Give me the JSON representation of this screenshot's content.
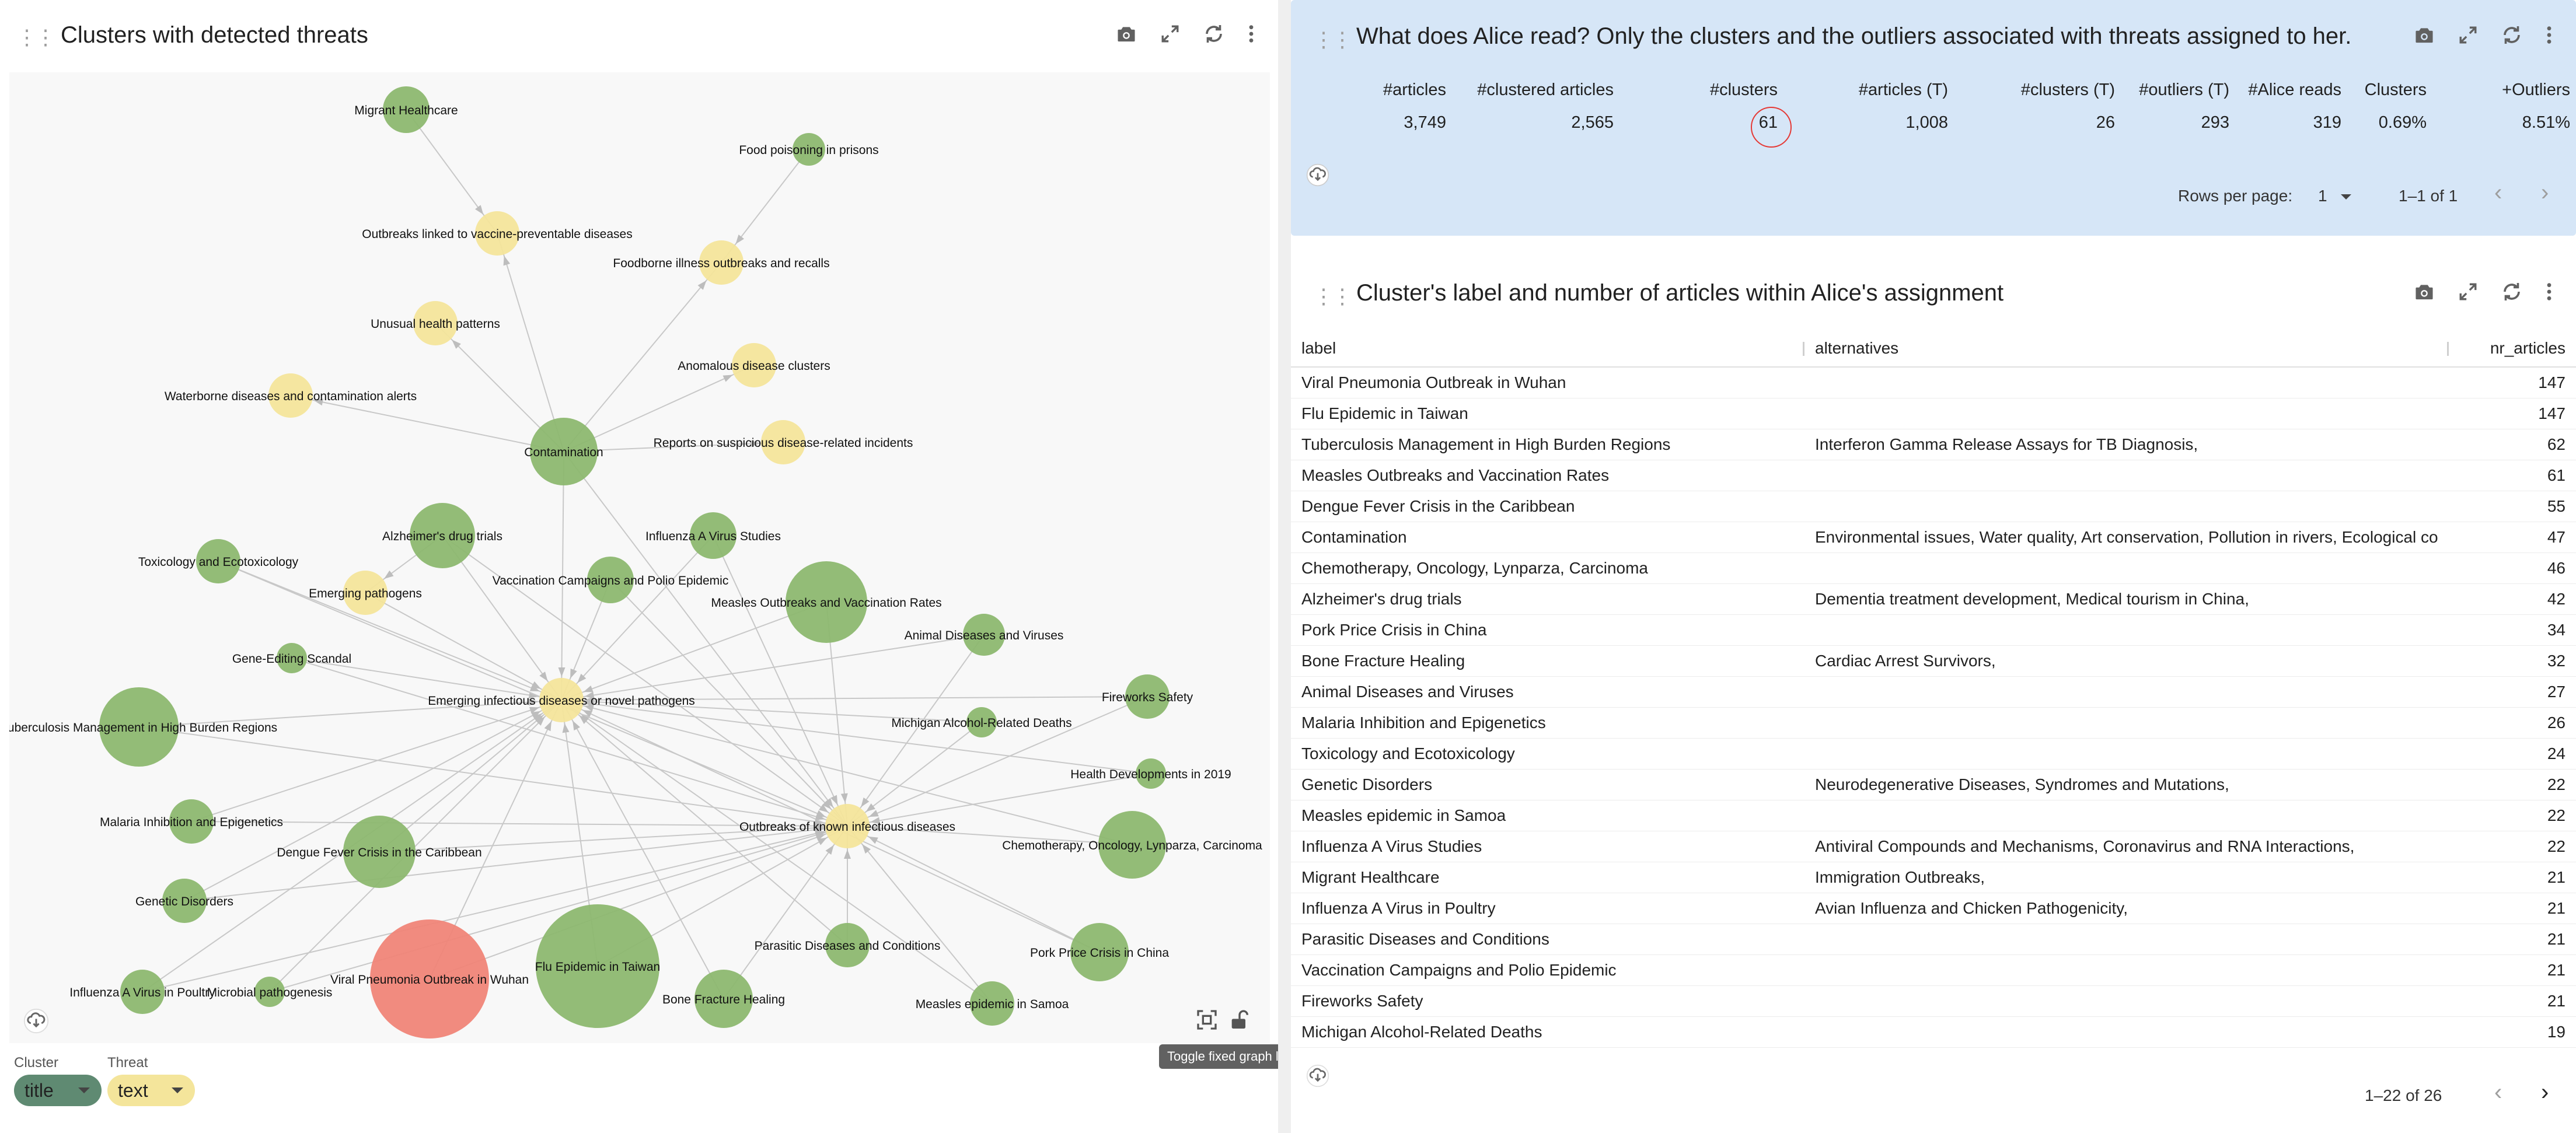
{
  "left": {
    "title": "Clusters with detected threats",
    "legend": {
      "cluster_header": "Cluster",
      "cluster_value": "title",
      "threat_header": "Threat",
      "threat_value": "text"
    },
    "tooltip": "Toggle fixed graph layout."
  },
  "colors": {
    "cluster": "#8db870",
    "threat": "#f4e59b",
    "highlight": "#f08578",
    "panel_blue": "#d6e6f7"
  },
  "graph": {
    "nodes": [
      {
        "id": "migrant",
        "label": "Migrant Healthcare",
        "kind": "cluster"
      },
      {
        "id": "food",
        "label": "Food poisoning in prisons",
        "kind": "cluster"
      },
      {
        "id": "vaccprev",
        "label": "Outbreaks linked to vaccine-preventable diseases",
        "kind": "threat"
      },
      {
        "id": "foodborne",
        "label": "Foodborne illness outbreaks and recalls",
        "kind": "threat"
      },
      {
        "id": "unusual",
        "label": "Unusual health patterns",
        "kind": "threat"
      },
      {
        "id": "anomalous",
        "label": "Anomalous disease clusters",
        "kind": "threat"
      },
      {
        "id": "waterborne",
        "label": "Waterborne diseases and contamination alerts",
        "kind": "threat"
      },
      {
        "id": "contam",
        "label": "Contamination",
        "kind": "cluster"
      },
      {
        "id": "suspicious",
        "label": "Reports on suspicious disease-related incidents",
        "kind": "threat"
      },
      {
        "id": "alz",
        "label": "Alzheimer's drug trials",
        "kind": "cluster"
      },
      {
        "id": "flua",
        "label": "Influenza A Virus Studies",
        "kind": "cluster"
      },
      {
        "id": "toxic",
        "label": "Toxicology and Ecotoxicology",
        "kind": "cluster"
      },
      {
        "id": "vaccpolio",
        "label": "Vaccination Campaigns and Polio Epidemic",
        "kind": "cluster"
      },
      {
        "id": "emerging",
        "label": "Emerging pathogens",
        "kind": "threat"
      },
      {
        "id": "measlesvacc",
        "label": "Measles Outbreaks and Vaccination Rates",
        "kind": "cluster"
      },
      {
        "id": "animal",
        "label": "Animal Diseases and Viruses",
        "kind": "cluster"
      },
      {
        "id": "gene",
        "label": "Gene-Editing Scandal",
        "kind": "cluster"
      },
      {
        "id": "fireworks",
        "label": "Fireworks Safety",
        "kind": "cluster"
      },
      {
        "id": "eid",
        "label": "Emerging infectious diseases or novel pathogens",
        "kind": "threat"
      },
      {
        "id": "tb",
        "label": "Tuberculosis Management in High Burden Regions",
        "kind": "cluster"
      },
      {
        "id": "michigan",
        "label": "Michigan Alcohol-Related Deaths",
        "kind": "cluster"
      },
      {
        "id": "health2019",
        "label": "Health Developments in 2019",
        "kind": "cluster"
      },
      {
        "id": "malaria",
        "label": "Malaria Inhibition and Epigenetics",
        "kind": "cluster"
      },
      {
        "id": "known",
        "label": "Outbreaks of known infectious diseases",
        "kind": "threat"
      },
      {
        "id": "chemo",
        "label": "Chemotherapy, Oncology, Lynparza, Carcinoma",
        "kind": "cluster"
      },
      {
        "id": "dengue",
        "label": "Dengue Fever Crisis in the Caribbean",
        "kind": "cluster"
      },
      {
        "id": "genetic",
        "label": "Genetic Disorders",
        "kind": "cluster"
      },
      {
        "id": "parasitic",
        "label": "Parasitic Diseases and Conditions",
        "kind": "cluster"
      },
      {
        "id": "pork",
        "label": "Pork Price Crisis in China",
        "kind": "cluster"
      },
      {
        "id": "fluataiwan",
        "label": "Flu Epidemic in Taiwan",
        "kind": "cluster"
      },
      {
        "id": "wuhan",
        "label": "Viral Pneumonia Outbreak in Wuhan",
        "kind": "highlight"
      },
      {
        "id": "fluapoultry",
        "label": "Influenza A Virus in Poultry",
        "kind": "cluster"
      },
      {
        "id": "microbial",
        "label": "Microbial pathogenesis",
        "kind": "cluster"
      },
      {
        "id": "bone",
        "label": "Bone Fracture Healing",
        "kind": "cluster"
      },
      {
        "id": "samoa",
        "label": "Measles epidemic in Samoa",
        "kind": "cluster"
      }
    ]
  },
  "top_right": {
    "title": "What does Alice read? Only the clusters and the outliers associated with threats assigned to her.",
    "headers": [
      "#articles",
      "#clustered articles",
      "#clusters",
      "#articles (T)",
      "#clusters (T)",
      "#outliers (T)",
      "#Alice reads",
      "Clusters",
      "+Outliers"
    ],
    "values": [
      "3,749",
      "2,565",
      "61",
      "1,008",
      "26",
      "293",
      "319",
      "0.69%",
      "8.51%"
    ],
    "rows_per_page_label": "Rows per page:",
    "rows_per_page_value": "1",
    "range": "1–1 of 1"
  },
  "bottom_right": {
    "title": "Cluster's label and number of articles within Alice's assignment",
    "columns": [
      "label",
      "alternatives",
      "nr_articles"
    ],
    "rows": [
      [
        "Viral Pneumonia Outbreak in Wuhan",
        "",
        "147"
      ],
      [
        "Flu Epidemic in Taiwan",
        "",
        "147"
      ],
      [
        "Tuberculosis Management in High Burden Regions",
        "Interferon Gamma Release Assays for TB Diagnosis,",
        "62"
      ],
      [
        "Measles Outbreaks and Vaccination Rates",
        "",
        "61"
      ],
      [
        "Dengue Fever Crisis in the Caribbean",
        "",
        "55"
      ],
      [
        "Contamination",
        "Environmental issues, Water quality, Art conservation, Pollution in rivers, Ecological co",
        "47"
      ],
      [
        "Chemotherapy, Oncology, Lynparza, Carcinoma",
        "",
        "46"
      ],
      [
        "Alzheimer's drug trials",
        "Dementia treatment development, Medical tourism in China,",
        "42"
      ],
      [
        "Pork Price Crisis in China",
        "",
        "34"
      ],
      [
        "Bone Fracture Healing",
        "Cardiac Arrest Survivors,",
        "32"
      ],
      [
        "Animal Diseases and Viruses",
        "",
        "27"
      ],
      [
        "Malaria Inhibition and Epigenetics",
        "",
        "26"
      ],
      [
        "Toxicology and Ecotoxicology",
        "",
        "24"
      ],
      [
        "Genetic Disorders",
        "Neurodegenerative Diseases, Syndromes and Mutations,",
        "22"
      ],
      [
        "Measles epidemic in Samoa",
        "",
        "22"
      ],
      [
        "Influenza A Virus Studies",
        "Antiviral Compounds and Mechanisms, Coronavirus and RNA Interactions,",
        "22"
      ],
      [
        "Migrant Healthcare",
        "Immigration Outbreaks,",
        "21"
      ],
      [
        "Influenza A Virus in Poultry",
        "Avian Influenza and Chicken Pathogenicity,",
        "21"
      ],
      [
        "Parasitic Diseases and Conditions",
        "",
        "21"
      ],
      [
        "Vaccination Campaigns and Polio Epidemic",
        "",
        "21"
      ],
      [
        "Fireworks Safety",
        "",
        "21"
      ],
      [
        "Michigan Alcohol-Related Deaths",
        "",
        "19"
      ]
    ],
    "range": "1–22 of 26"
  }
}
